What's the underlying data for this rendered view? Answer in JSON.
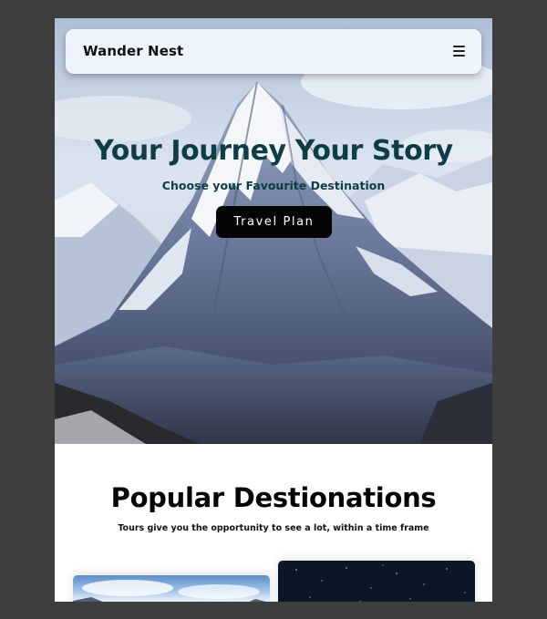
{
  "navbar": {
    "brand": "Wander Nest",
    "menu_icon": "hamburger-menu-icon"
  },
  "hero": {
    "title": "Your Journey Your Story",
    "subtitle": "Choose your Favourite Destination",
    "cta_label": "Travel Plan",
    "background": "snow-capped-mountain-photo"
  },
  "destinations": {
    "title": "Popular Destionations",
    "subtitle": "Tours give you the opportunity to see a lot, within a time frame",
    "cards": [
      {
        "image": "mountain-sky-photo"
      },
      {
        "image": "starry-night-photo"
      }
    ]
  },
  "colors": {
    "page_background": "#3e3e3e",
    "navbar_background": "#eef4fc",
    "hero_text": "#0f3d45",
    "cta_background": "#050505",
    "cta_text": "#ffffff"
  }
}
